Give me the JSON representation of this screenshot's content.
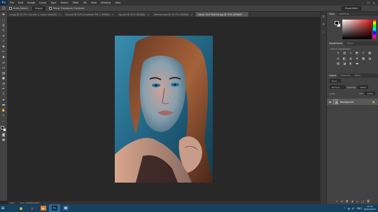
{
  "app": {
    "logo": "Ps"
  },
  "menubar": {
    "items": [
      "File",
      "Edit",
      "Image",
      "Layer",
      "Type",
      "Select",
      "Filter",
      "3D",
      "View",
      "Window",
      "Help"
    ],
    "window_controls": [
      "–",
      "❐",
      "✕"
    ]
  },
  "options": {
    "tool_icon": "◫",
    "mode_label": "Auto-Select:",
    "mode_value": "Group",
    "transform_label": "Show Transform Controls",
    "workspace": "Essentials"
  },
  "tabs": [
    {
      "label": "Hugg @ 33.3% (Curves 1, Layer Mask/8)",
      "active": false
    },
    {
      "label": "Fix.psd @ 50% (Gradient Fill 1, RGB/8)",
      "active": false
    },
    {
      "label": "bg.psd @ 25% (RGB/8)",
      "active": false
    },
    {
      "label": "Woman.psd @ 33.3% (RGB/8)",
      "active": false
    },
    {
      "label": "Colour Grd Portrait.jpg @ 33% (RGB/8)",
      "active": true
    }
  ],
  "tab_close": "×",
  "status": {
    "zoom": "33%",
    "doc": "Doc: 4.83M/4.83M",
    "arrow": "›"
  },
  "tools": [
    {
      "name": "move-tool-icon",
      "glyph": "✥"
    },
    {
      "name": "marquee-tool-icon",
      "glyph": "⬚"
    },
    {
      "name": "lasso-tool-icon",
      "glyph": "ᘐ"
    },
    {
      "name": "quick-select-tool-icon",
      "glyph": "✎"
    },
    {
      "name": "crop-tool-icon",
      "glyph": "⌗"
    },
    {
      "name": "eyedropper-tool-icon",
      "glyph": "⁄"
    },
    {
      "name": "healing-tool-icon",
      "glyph": "✚"
    },
    {
      "name": "brush-tool-icon",
      "glyph": "✏"
    },
    {
      "name": "clone-stamp-tool-icon",
      "glyph": "♣"
    },
    {
      "name": "history-brush-tool-icon",
      "glyph": "↺"
    },
    {
      "name": "eraser-tool-icon",
      "glyph": "▭"
    },
    {
      "name": "gradient-tool-icon",
      "glyph": "▤"
    },
    {
      "name": "blur-tool-icon",
      "glyph": "●"
    },
    {
      "name": "dodge-tool-icon",
      "glyph": "◔"
    },
    {
      "name": "pen-tool-icon",
      "glyph": "✒"
    },
    {
      "name": "type-tool-icon",
      "glyph": "T"
    },
    {
      "name": "path-select-tool-icon",
      "glyph": "➤"
    },
    {
      "name": "shape-tool-icon",
      "glyph": "▬"
    },
    {
      "name": "hand-tool-icon",
      "glyph": "✋"
    },
    {
      "name": "zoom-tool-icon",
      "glyph": "⌕"
    },
    {
      "name": "edit-toolbar-icon",
      "glyph": "…"
    }
  ],
  "tools_after": [
    {
      "name": "quick-mask-icon",
      "glyph": "◙"
    },
    {
      "name": "screen-mode-icon",
      "glyph": "▣"
    }
  ],
  "mini_strip": [
    {
      "name": "history-panel-icon",
      "glyph": "⏲"
    },
    {
      "name": "properties-panel-icon",
      "glyph": "☰"
    },
    {
      "name": "info-panel-icon",
      "glyph": "ⓘ"
    }
  ],
  "panels": {
    "color_tabs": [
      "Color",
      "Swatches"
    ],
    "adjust_tabs": [
      "Adjustments",
      "Styles"
    ],
    "adjust_title": "Add an adjustment",
    "adjust_icons": [
      {
        "name": "brightness-contrast-icon",
        "glyph": "☀"
      },
      {
        "name": "levels-icon",
        "glyph": "▥"
      },
      {
        "name": "curves-icon",
        "glyph": "∿"
      },
      {
        "name": "exposure-icon",
        "glyph": "◩"
      },
      {
        "name": "vibrance-icon",
        "glyph": "▽"
      },
      {
        "name": "hue-saturation-icon",
        "glyph": "▦"
      },
      {
        "name": "color-balance-icon",
        "glyph": "⚖"
      },
      {
        "name": "black-white-icon",
        "glyph": "◧"
      },
      {
        "name": "photo-filter-icon",
        "glyph": "◍"
      },
      {
        "name": "channel-mixer-icon",
        "glyph": "⊗"
      },
      {
        "name": "color-lookup-icon",
        "glyph": "▦"
      },
      {
        "name": "invert-icon",
        "glyph": "◑"
      },
      {
        "name": "posterize-icon",
        "glyph": "▨"
      },
      {
        "name": "threshold-icon",
        "glyph": "◪"
      },
      {
        "name": "selective-color-icon",
        "glyph": "◐"
      },
      {
        "name": "gradient-map-icon",
        "glyph": "▬"
      }
    ],
    "layer_tabs": [
      "Layers",
      "Channels",
      "Paths"
    ],
    "kind_value": "Kind",
    "blend_value": "Normal",
    "opacity_label": "Opacity:",
    "opacity_value": "100%",
    "lock_label": "Lock:",
    "fill_label": "Fill:",
    "fill_value": "100%",
    "layer": {
      "name": "Background",
      "eye": "◉",
      "lock": "🔒"
    },
    "footer_icons": [
      {
        "name": "link-layers-icon",
        "glyph": "⚭"
      },
      {
        "name": "fx-icon",
        "glyph": "fx"
      },
      {
        "name": "add-mask-icon",
        "glyph": "◘"
      },
      {
        "name": "new-adjustment-icon",
        "glyph": "◑"
      },
      {
        "name": "new-group-icon",
        "glyph": "▭"
      },
      {
        "name": "new-layer-icon",
        "glyph": "❏"
      },
      {
        "name": "delete-layer-icon",
        "glyph": "🗑"
      }
    ]
  },
  "taskbar": {
    "start": "⊞",
    "apps": [
      {
        "name": "explorer-app-icon",
        "glyph": "▆",
        "color": "#f0c33c",
        "bg": "",
        "active": false
      },
      {
        "name": "chrome-app-icon",
        "glyph": "◉",
        "color": "#e04a3b",
        "bg": "",
        "active": false
      },
      {
        "name": "media-app-icon",
        "glyph": "▶",
        "color": "#ffffff",
        "bg": "#e07b18",
        "active": false
      },
      {
        "name": "photoshop-app-icon",
        "glyph": "Ps",
        "color": "#31a8ff",
        "bg": "#0c2235",
        "active": true
      },
      {
        "name": "word-app-icon",
        "glyph": "W",
        "color": "#ffffff",
        "bg": "#2b579a",
        "active": false
      }
    ],
    "tray": {
      "chevron": "^",
      "network": "▥",
      "volume": "🔊",
      "lang": "ENG",
      "time": "11:21",
      "date": "05/01/2017"
    }
  },
  "colors": {
    "accent": "#31a8ff",
    "taskbar": "#16405e",
    "panel": "#424242"
  }
}
